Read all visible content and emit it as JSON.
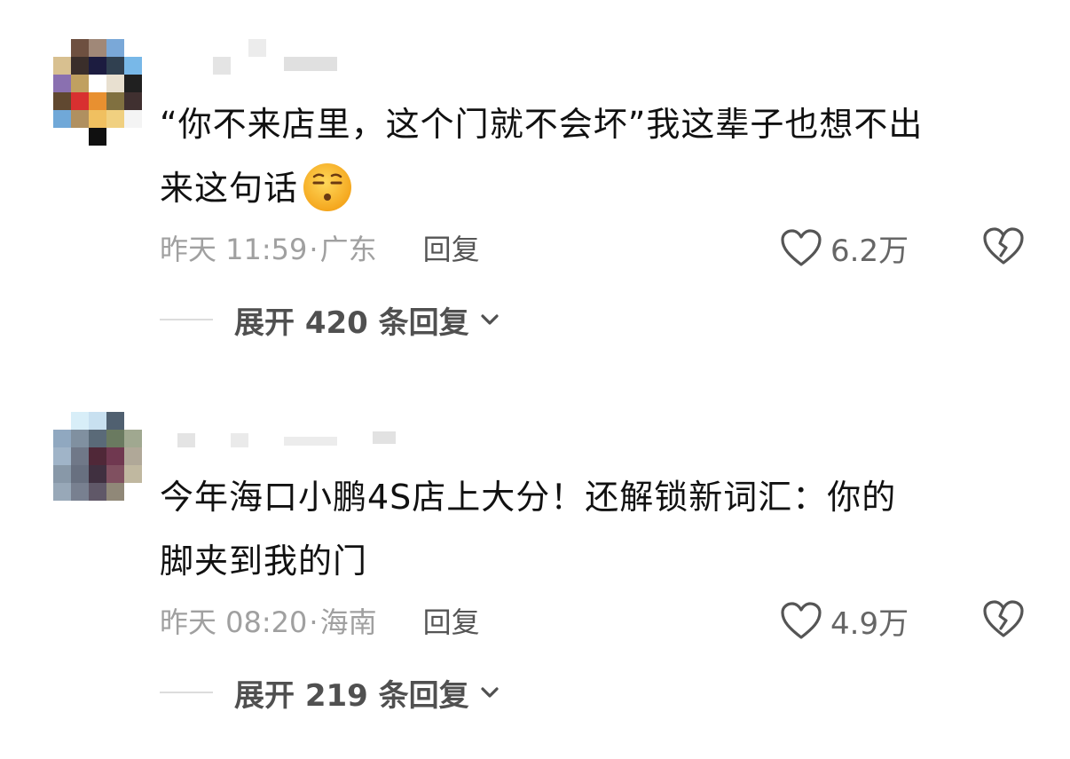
{
  "comments": [
    {
      "text_line1": "“你不来店里，这个门就不会坏”我这辈子也想不出",
      "text_line2": "来这句话",
      "time": "昨天 11:59",
      "location": "广东",
      "reply_label": "回复",
      "likes": "6.2万",
      "expand_label": "展开 420 条回复"
    },
    {
      "text_line1": "今年海口小鹏4S店上大分！还解锁新词汇：你的",
      "text_line2": "脚夹到我的门",
      "time": "昨天 08:20",
      "location": "海南",
      "reply_label": "回复",
      "likes": "4.9万",
      "expand_label": "展开 219 条回复"
    }
  ],
  "separator": "·",
  "icons": {
    "like": "heart-outline-icon",
    "dislike": "broken-heart-icon",
    "expand": "chevron-down-icon",
    "emoji": "dizzy-face-emoji"
  },
  "colors": {
    "text": "#111111",
    "meta": "#a0a0a0",
    "action": "#555555"
  }
}
